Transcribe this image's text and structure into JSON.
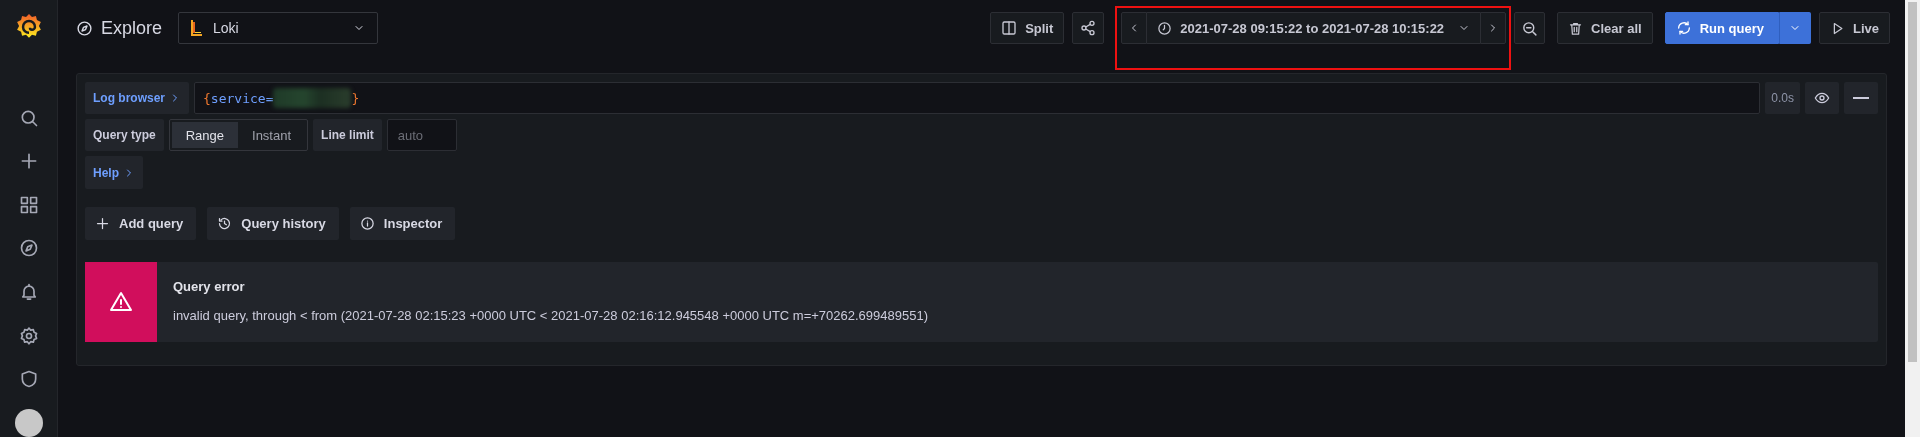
{
  "page": {
    "title": "Explore"
  },
  "datasource": {
    "name": "Loki"
  },
  "toolbar": {
    "split": "Split",
    "time_range": {
      "label": "2021-07-28 09:15:22 to 2021-07-28 10:15:22",
      "highlighted": true
    },
    "clear": "Clear all",
    "run": "Run query",
    "live": "Live"
  },
  "query": {
    "log_browser": "Log browser",
    "expression": [
      {
        "kind": "brace",
        "text": "{"
      },
      {
        "kind": "label",
        "text": "service="
      },
      {
        "kind": "redacted"
      },
      {
        "kind": "brace",
        "text": "}"
      }
    ],
    "duration": "0.0s",
    "query_type_label": "Query type",
    "query_types": [
      {
        "label": "Range",
        "selected": true
      },
      {
        "label": "Instant",
        "selected": false
      }
    ],
    "line_limit_label": "Line limit",
    "line_limit": {
      "placeholder": "auto"
    },
    "help": "Help"
  },
  "actions": [
    {
      "kind": "add",
      "label": "Add query"
    },
    {
      "kind": "history",
      "label": "Query history"
    },
    {
      "kind": "info",
      "label": "Inspector"
    }
  ],
  "error": {
    "title": "Query error",
    "message": "invalid query, through < from (2021-07-28 02:15:23 +0000 UTC < 2021-07-28 02:16:12.945548 +0000 UTC m=+70262.699489551)"
  }
}
